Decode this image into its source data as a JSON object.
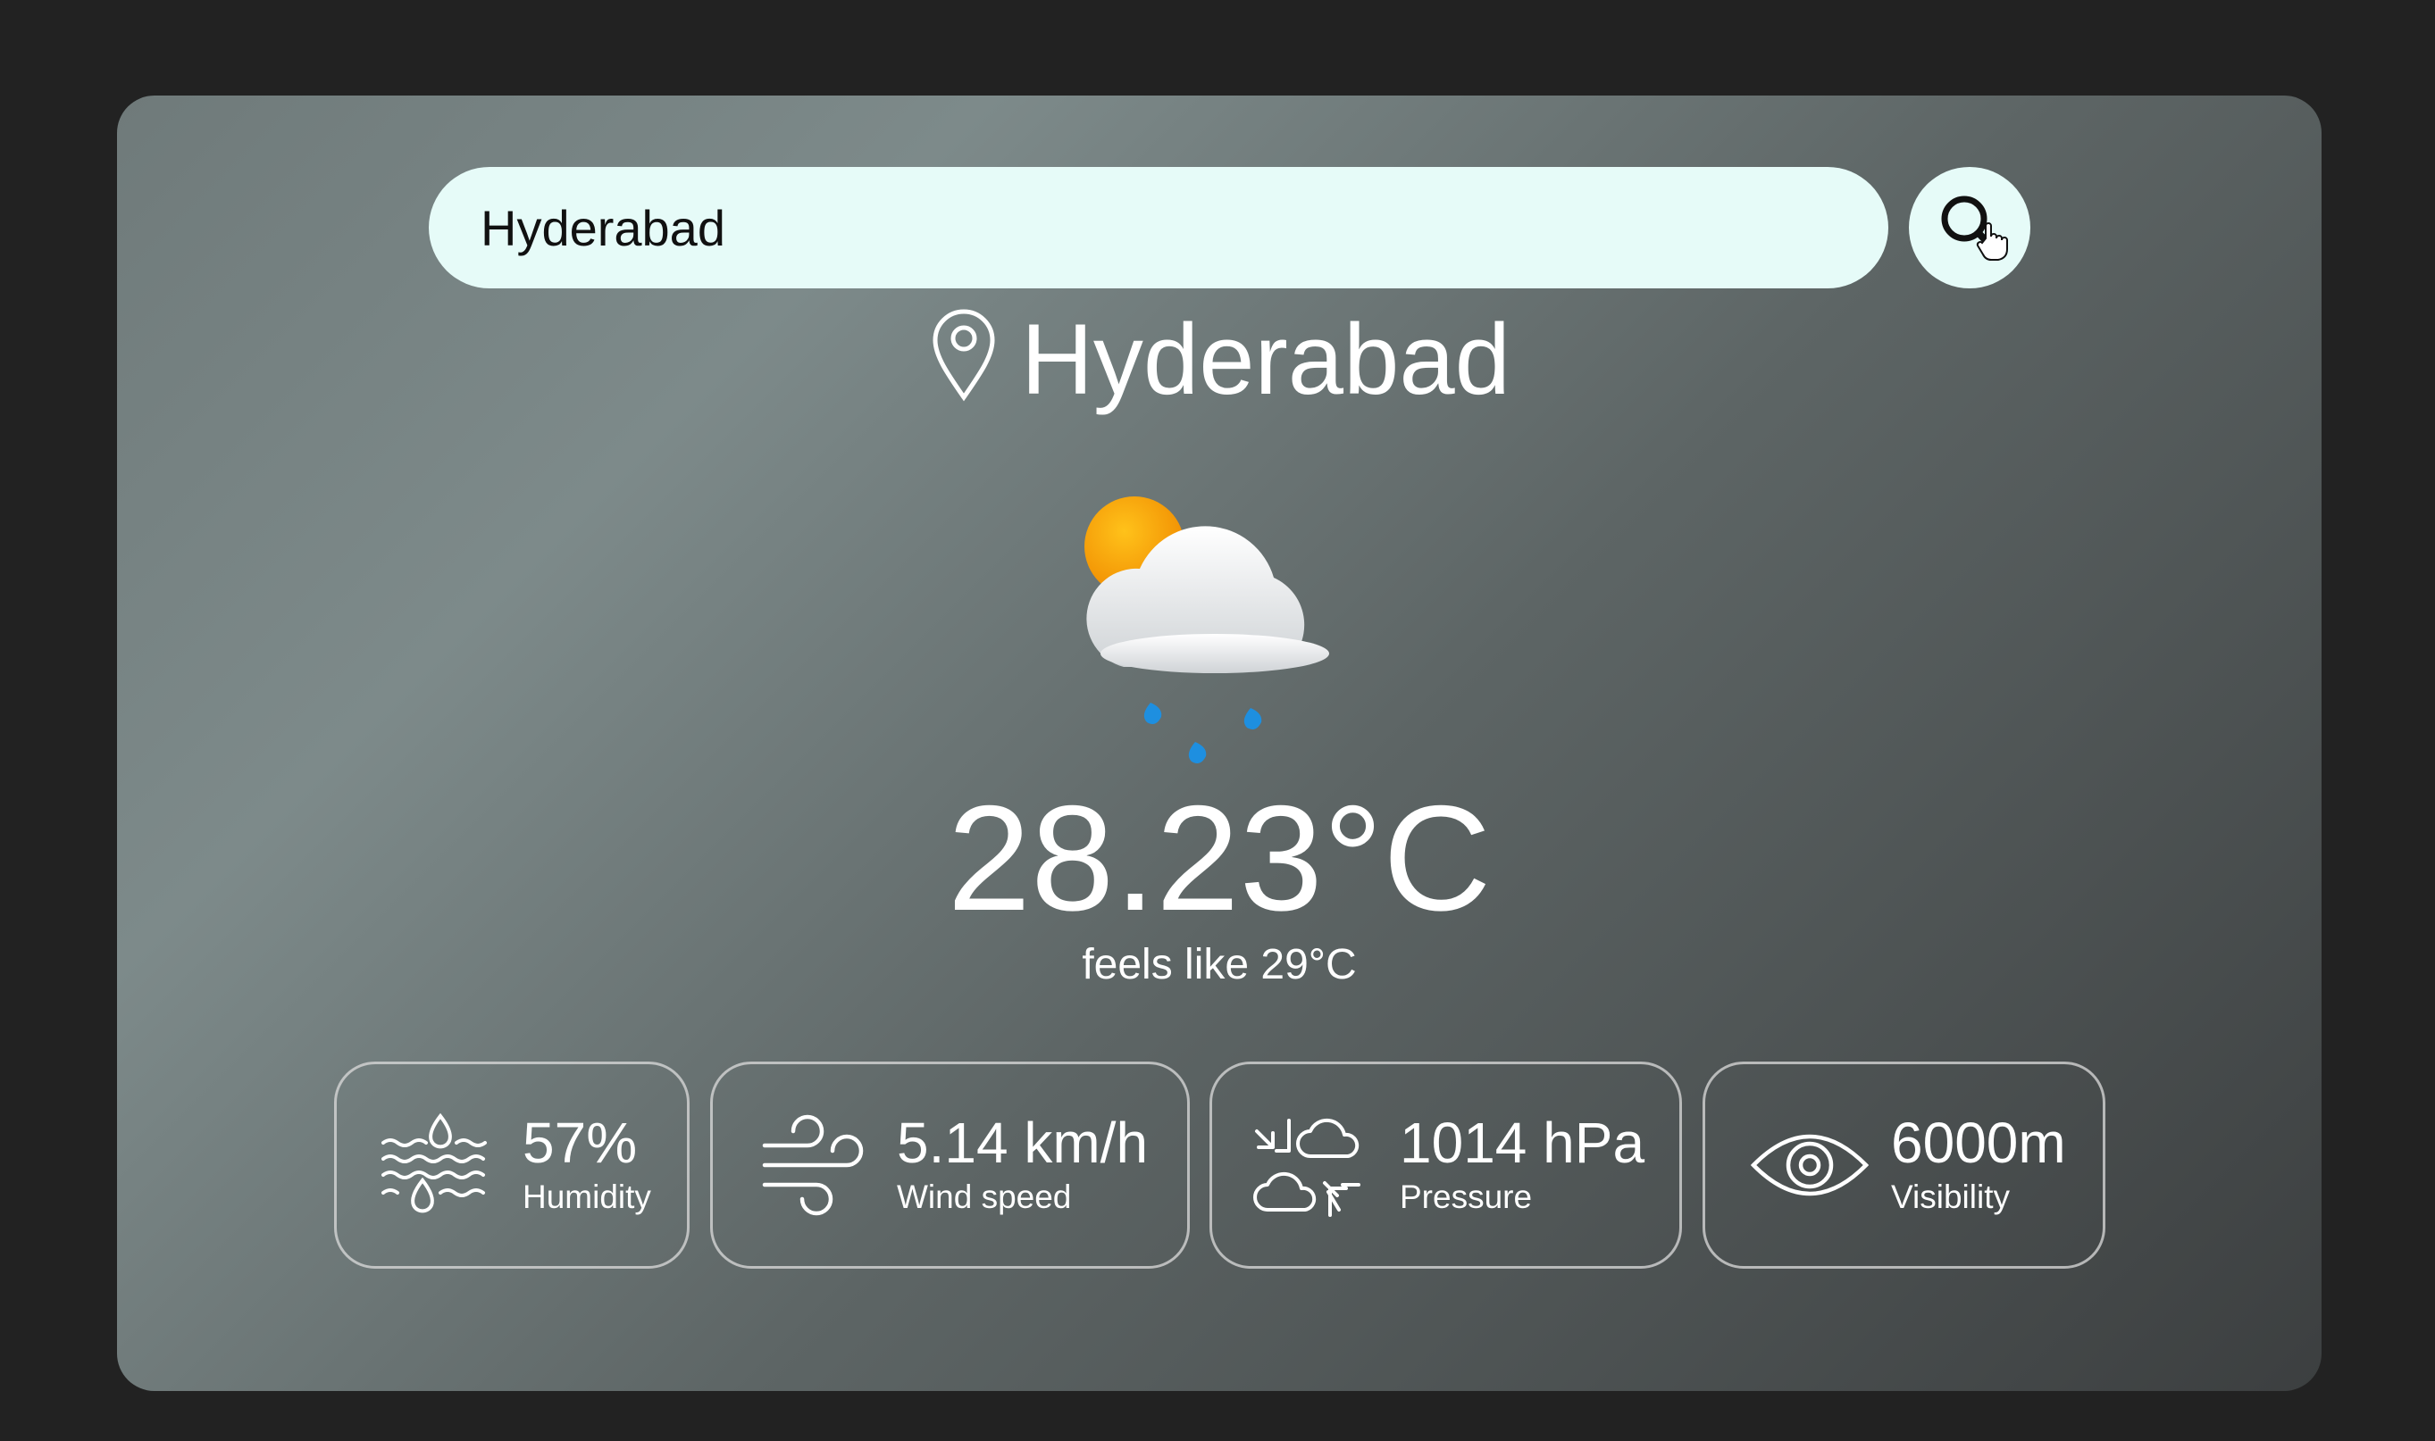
{
  "search": {
    "value": "Hyderabad"
  },
  "location": {
    "city": "Hyderabad"
  },
  "weather": {
    "icon": "partly-cloudy-rain-icon",
    "temperature": "28.23°C",
    "feels_like": "feels like 29°C"
  },
  "stats": [
    {
      "icon": "humidity-icon",
      "value": "57%",
      "label": "Humidity"
    },
    {
      "icon": "wind-icon",
      "value": "5.14 km/h",
      "label": "Wind speed"
    },
    {
      "icon": "pressure-icon",
      "value": "1014 hPa",
      "label": "Pressure"
    },
    {
      "icon": "eye-icon",
      "value": "6000m",
      "label": "Visibility"
    }
  ],
  "colors": {
    "page_background": "#222222",
    "search_background": "#e6fbf8",
    "text": "#ffffff"
  }
}
